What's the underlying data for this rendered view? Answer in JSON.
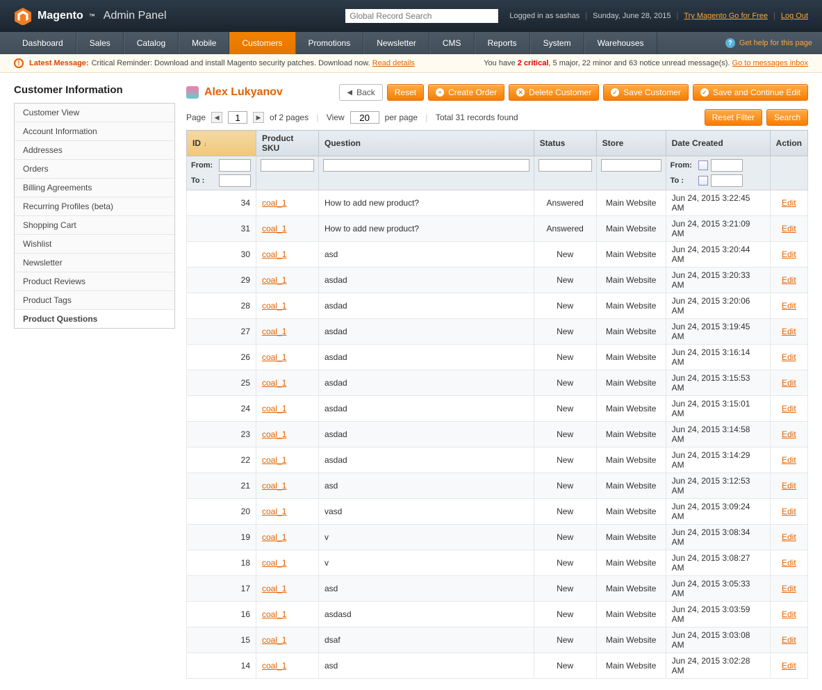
{
  "header": {
    "brand": "Magento",
    "panel": "Admin Panel",
    "search_placeholder": "Global Record Search",
    "logged_in": "Logged in as sashas",
    "date": "Sunday, June 28, 2015",
    "try_link": "Try Magento Go for Free",
    "logout": "Log Out"
  },
  "nav": {
    "items": [
      "Dashboard",
      "Sales",
      "Catalog",
      "Mobile",
      "Customers",
      "Promotions",
      "Newsletter",
      "CMS",
      "Reports",
      "System",
      "Warehouses"
    ],
    "active_index": 4,
    "help": "Get help for this page"
  },
  "msgbar": {
    "latest_label": "Latest Message:",
    "latest_text": "Critical Reminder: Download and install Magento security patches. Download now.",
    "read_details": "Read details",
    "right_prefix": "You have ",
    "critical": "2 critical",
    "rest": ", 5 major, 22 minor and 63 notice unread message(s). ",
    "go_link": "Go to messages inbox"
  },
  "sidebar": {
    "heading": "Customer Information",
    "items": [
      "Customer View",
      "Account Information",
      "Addresses",
      "Orders",
      "Billing Agreements",
      "Recurring Profiles (beta)",
      "Shopping Cart",
      "Wishlist",
      "Newsletter",
      "Product Reviews",
      "Product Tags",
      "Product Questions"
    ],
    "active_index": 11
  },
  "page": {
    "customer_name": "Alex Lukyanov",
    "buttons": {
      "back": "Back",
      "reset": "Reset",
      "create_order": "Create Order",
      "delete": "Delete Customer",
      "save": "Save Customer",
      "save_continue": "Save and Continue Edit"
    }
  },
  "toolbar": {
    "page_label": "Page",
    "page_value": "1",
    "of_pages": "of 2 pages",
    "view_label": "View",
    "perpage_value": "20",
    "perpage_label": "per page",
    "total": "Total 31 records found",
    "reset_filter": "Reset Filter",
    "search": "Search"
  },
  "grid": {
    "columns": [
      "ID",
      "Product SKU",
      "Question",
      "Status",
      "Store",
      "Date Created",
      "Action"
    ],
    "filters": {
      "from": "From:",
      "to": "To :"
    },
    "rows": [
      {
        "id": "34",
        "sku": "coal_1",
        "q": "How to add new product?",
        "status": "Answered",
        "store": "Main Website",
        "date": "Jun 24, 2015 3:22:45 AM",
        "action": "Edit"
      },
      {
        "id": "31",
        "sku": "coal_1",
        "q": "How to add new product?",
        "status": "Answered",
        "store": "Main Website",
        "date": "Jun 24, 2015 3:21:09 AM",
        "action": "Edit"
      },
      {
        "id": "30",
        "sku": "coal_1",
        "q": "asd",
        "status": "New",
        "store": "Main Website",
        "date": "Jun 24, 2015 3:20:44 AM",
        "action": "Edit"
      },
      {
        "id": "29",
        "sku": "coal_1",
        "q": "asdad",
        "status": "New",
        "store": "Main Website",
        "date": "Jun 24, 2015 3:20:33 AM",
        "action": "Edit"
      },
      {
        "id": "28",
        "sku": "coal_1",
        "q": "asdad",
        "status": "New",
        "store": "Main Website",
        "date": "Jun 24, 2015 3:20:06 AM",
        "action": "Edit"
      },
      {
        "id": "27",
        "sku": "coal_1",
        "q": "asdad",
        "status": "New",
        "store": "Main Website",
        "date": "Jun 24, 2015 3:19:45 AM",
        "action": "Edit"
      },
      {
        "id": "26",
        "sku": "coal_1",
        "q": "asdad",
        "status": "New",
        "store": "Main Website",
        "date": "Jun 24, 2015 3:16:14 AM",
        "action": "Edit"
      },
      {
        "id": "25",
        "sku": "coal_1",
        "q": "asdad",
        "status": "New",
        "store": "Main Website",
        "date": "Jun 24, 2015 3:15:53 AM",
        "action": "Edit"
      },
      {
        "id": "24",
        "sku": "coal_1",
        "q": "asdad",
        "status": "New",
        "store": "Main Website",
        "date": "Jun 24, 2015 3:15:01 AM",
        "action": "Edit"
      },
      {
        "id": "23",
        "sku": "coal_1",
        "q": "asdad",
        "status": "New",
        "store": "Main Website",
        "date": "Jun 24, 2015 3:14:58 AM",
        "action": "Edit"
      },
      {
        "id": "22",
        "sku": "coal_1",
        "q": "asdad",
        "status": "New",
        "store": "Main Website",
        "date": "Jun 24, 2015 3:14:29 AM",
        "action": "Edit"
      },
      {
        "id": "21",
        "sku": "coal_1",
        "q": "asd",
        "status": "New",
        "store": "Main Website",
        "date": "Jun 24, 2015 3:12:53 AM",
        "action": "Edit"
      },
      {
        "id": "20",
        "sku": "coal_1",
        "q": "vasd",
        "status": "New",
        "store": "Main Website",
        "date": "Jun 24, 2015 3:09:24 AM",
        "action": "Edit"
      },
      {
        "id": "19",
        "sku": "coal_1",
        "q": "v",
        "status": "New",
        "store": "Main Website",
        "date": "Jun 24, 2015 3:08:34 AM",
        "action": "Edit"
      },
      {
        "id": "18",
        "sku": "coal_1",
        "q": "v",
        "status": "New",
        "store": "Main Website",
        "date": "Jun 24, 2015 3:08:27 AM",
        "action": "Edit"
      },
      {
        "id": "17",
        "sku": "coal_1",
        "q": "asd",
        "status": "New",
        "store": "Main Website",
        "date": "Jun 24, 2015 3:05:33 AM",
        "action": "Edit"
      },
      {
        "id": "16",
        "sku": "coal_1",
        "q": "asdasd",
        "status": "New",
        "store": "Main Website",
        "date": "Jun 24, 2015 3:03:59 AM",
        "action": "Edit"
      },
      {
        "id": "15",
        "sku": "coal_1",
        "q": "dsaf",
        "status": "New",
        "store": "Main Website",
        "date": "Jun 24, 2015 3:03:08 AM",
        "action": "Edit"
      },
      {
        "id": "14",
        "sku": "coal_1",
        "q": "asd",
        "status": "New",
        "store": "Main Website",
        "date": "Jun 24, 2015 3:02:28 AM",
        "action": "Edit"
      }
    ]
  }
}
